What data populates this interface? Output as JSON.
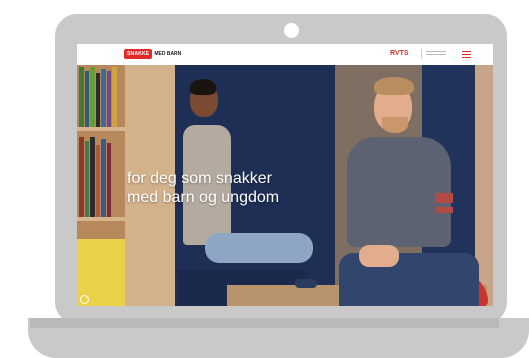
{
  "site": {
    "logo_badge": "SNAKKE",
    "logo_text": "MED BARN",
    "partner_logo": "RVTS"
  },
  "hero": {
    "headline_line1": "for deg som snakker",
    "headline_line2": "med barn og ungdom"
  },
  "icons": {
    "menu": "hamburger-menu-icon",
    "camera": "webcam-dot",
    "scroll": "scroll-indicator-icon"
  },
  "colors": {
    "brand_red": "#e22a2a",
    "laptop_frame": "#c9c9c9",
    "hero_text": "#ffffff"
  }
}
